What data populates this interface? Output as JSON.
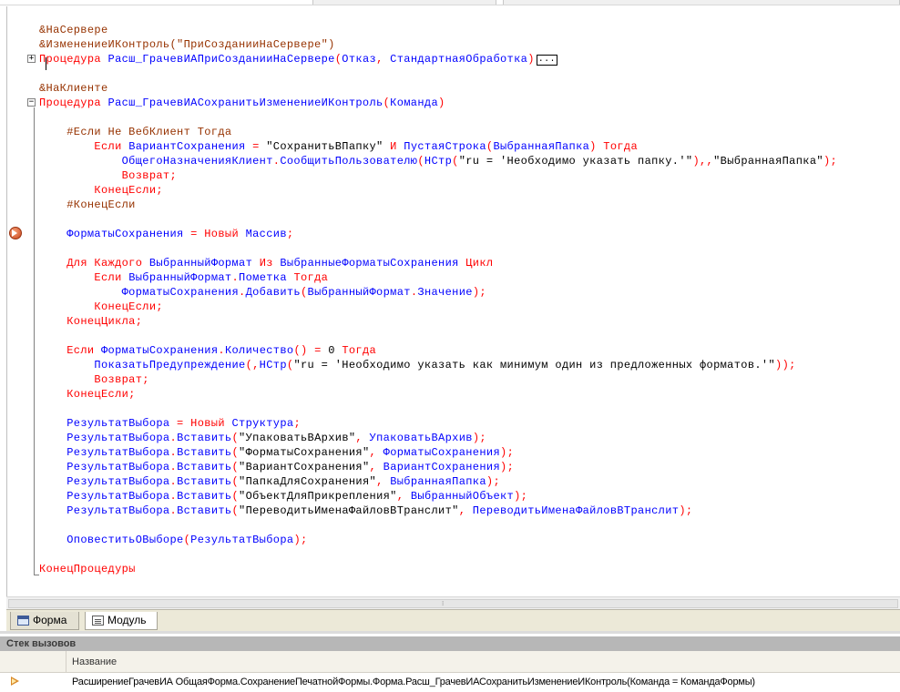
{
  "code_lines": [
    [
      {
        "c": "dir",
        "t": "&НаСервере"
      }
    ],
    [
      {
        "c": "dir",
        "t": "&ИзменениеИКонтроль(\"ПриСозданииНаСервере\")"
      }
    ],
    [
      {
        "c": "kw",
        "t": "Процедура"
      },
      {
        "c": "txt",
        "t": " "
      },
      {
        "c": "id",
        "t": "Расш_ГрачевИАПриСозданииНаСервере"
      },
      {
        "c": "kw",
        "t": "("
      },
      {
        "c": "id",
        "t": "Отказ"
      },
      {
        "c": "kw",
        "t": ", "
      },
      {
        "c": "id",
        "t": "СтандартнаяОбработка"
      },
      {
        "c": "kw",
        "t": ")"
      }
    ],
    [],
    [
      {
        "c": "dir",
        "t": "&НаКлиенте"
      }
    ],
    [
      {
        "c": "kw",
        "t": "Процедура"
      },
      {
        "c": "txt",
        "t": " "
      },
      {
        "c": "id",
        "t": "Расш_ГрачевИАСохранитьИзменениеИКонтроль"
      },
      {
        "c": "kw",
        "t": "("
      },
      {
        "c": "id",
        "t": "Команда"
      },
      {
        "c": "kw",
        "t": ")"
      }
    ],
    [],
    [
      {
        "c": "txt",
        "t": "    "
      },
      {
        "c": "dir",
        "t": "#Если Не ВебКлиент Тогда"
      }
    ],
    [
      {
        "c": "txt",
        "t": "        "
      },
      {
        "c": "kw",
        "t": "Если"
      },
      {
        "c": "txt",
        "t": " "
      },
      {
        "c": "id",
        "t": "ВариантСохранения"
      },
      {
        "c": "kw",
        "t": " = "
      },
      {
        "c": "txt",
        "t": "\"СохранитьВПапку\""
      },
      {
        "c": "kw",
        "t": " И "
      },
      {
        "c": "id",
        "t": "ПустаяСтрока"
      },
      {
        "c": "kw",
        "t": "("
      },
      {
        "c": "id",
        "t": "ВыбраннаяПапка"
      },
      {
        "c": "kw",
        "t": ") Тогда"
      }
    ],
    [
      {
        "c": "txt",
        "t": "            "
      },
      {
        "c": "id",
        "t": "ОбщегоНазначенияКлиент"
      },
      {
        "c": "kw",
        "t": "."
      },
      {
        "c": "id",
        "t": "СообщитьПользователю"
      },
      {
        "c": "kw",
        "t": "("
      },
      {
        "c": "id",
        "t": "НСтр"
      },
      {
        "c": "kw",
        "t": "("
      },
      {
        "c": "txt",
        "t": "\"ru = 'Необходимо указать папку.'\""
      },
      {
        "c": "kw",
        "t": "),,"
      },
      {
        "c": "txt",
        "t": "\"ВыбраннаяПапка\""
      },
      {
        "c": "kw",
        "t": ");"
      }
    ],
    [
      {
        "c": "txt",
        "t": "            "
      },
      {
        "c": "kw",
        "t": "Возврат;"
      }
    ],
    [
      {
        "c": "txt",
        "t": "        "
      },
      {
        "c": "kw",
        "t": "КонецЕсли;"
      }
    ],
    [
      {
        "c": "txt",
        "t": "    "
      },
      {
        "c": "dir",
        "t": "#КонецЕсли"
      }
    ],
    [],
    [
      {
        "c": "txt",
        "t": "    "
      },
      {
        "c": "id",
        "t": "ФорматыСохранения"
      },
      {
        "c": "kw",
        "t": " = Новый "
      },
      {
        "c": "id",
        "t": "Массив"
      },
      {
        "c": "kw",
        "t": ";"
      }
    ],
    [],
    [
      {
        "c": "txt",
        "t": "    "
      },
      {
        "c": "kw",
        "t": "Для Каждого"
      },
      {
        "c": "txt",
        "t": " "
      },
      {
        "c": "id",
        "t": "ВыбранныйФормат"
      },
      {
        "c": "kw",
        "t": " Из "
      },
      {
        "c": "id",
        "t": "ВыбранныеФорматыСохранения"
      },
      {
        "c": "kw",
        "t": " Цикл"
      }
    ],
    [
      {
        "c": "txt",
        "t": "        "
      },
      {
        "c": "kw",
        "t": "Если"
      },
      {
        "c": "txt",
        "t": " "
      },
      {
        "c": "id",
        "t": "ВыбранныйФормат"
      },
      {
        "c": "kw",
        "t": "."
      },
      {
        "c": "id",
        "t": "Пометка"
      },
      {
        "c": "kw",
        "t": " Тогда"
      }
    ],
    [
      {
        "c": "txt",
        "t": "            "
      },
      {
        "c": "id",
        "t": "ФорматыСохранения"
      },
      {
        "c": "kw",
        "t": "."
      },
      {
        "c": "id",
        "t": "Добавить"
      },
      {
        "c": "kw",
        "t": "("
      },
      {
        "c": "id",
        "t": "ВыбранныйФормат"
      },
      {
        "c": "kw",
        "t": "."
      },
      {
        "c": "id",
        "t": "Значение"
      },
      {
        "c": "kw",
        "t": ");"
      }
    ],
    [
      {
        "c": "txt",
        "t": "        "
      },
      {
        "c": "kw",
        "t": "КонецЕсли;"
      }
    ],
    [
      {
        "c": "txt",
        "t": "    "
      },
      {
        "c": "kw",
        "t": "КонецЦикла;"
      }
    ],
    [],
    [
      {
        "c": "txt",
        "t": "    "
      },
      {
        "c": "kw",
        "t": "Если"
      },
      {
        "c": "txt",
        "t": " "
      },
      {
        "c": "id",
        "t": "ФорматыСохранения"
      },
      {
        "c": "kw",
        "t": "."
      },
      {
        "c": "id",
        "t": "Количество"
      },
      {
        "c": "kw",
        "t": "() = "
      },
      {
        "c": "txt",
        "t": "0"
      },
      {
        "c": "kw",
        "t": " Тогда"
      }
    ],
    [
      {
        "c": "txt",
        "t": "        "
      },
      {
        "c": "id",
        "t": "ПоказатьПредупреждение"
      },
      {
        "c": "kw",
        "t": "(,"
      },
      {
        "c": "id",
        "t": "НСтр"
      },
      {
        "c": "kw",
        "t": "("
      },
      {
        "c": "txt",
        "t": "\"ru = 'Необходимо указать как минимум один из предложенных форматов.'\""
      },
      {
        "c": "kw",
        "t": "));"
      }
    ],
    [
      {
        "c": "txt",
        "t": "        "
      },
      {
        "c": "kw",
        "t": "Возврат;"
      }
    ],
    [
      {
        "c": "txt",
        "t": "    "
      },
      {
        "c": "kw",
        "t": "КонецЕсли;"
      }
    ],
    [],
    [
      {
        "c": "txt",
        "t": "    "
      },
      {
        "c": "id",
        "t": "РезультатВыбора"
      },
      {
        "c": "kw",
        "t": " = Новый "
      },
      {
        "c": "id",
        "t": "Структура"
      },
      {
        "c": "kw",
        "t": ";"
      }
    ],
    [
      {
        "c": "txt",
        "t": "    "
      },
      {
        "c": "id",
        "t": "РезультатВыбора"
      },
      {
        "c": "kw",
        "t": "."
      },
      {
        "c": "id",
        "t": "Вставить"
      },
      {
        "c": "kw",
        "t": "("
      },
      {
        "c": "txt",
        "t": "\"УпаковатьВАрхив\""
      },
      {
        "c": "kw",
        "t": ", "
      },
      {
        "c": "id",
        "t": "УпаковатьВАрхив"
      },
      {
        "c": "kw",
        "t": ");"
      }
    ],
    [
      {
        "c": "txt",
        "t": "    "
      },
      {
        "c": "id",
        "t": "РезультатВыбора"
      },
      {
        "c": "kw",
        "t": "."
      },
      {
        "c": "id",
        "t": "Вставить"
      },
      {
        "c": "kw",
        "t": "("
      },
      {
        "c": "txt",
        "t": "\"ФорматыСохранения\""
      },
      {
        "c": "kw",
        "t": ", "
      },
      {
        "c": "id",
        "t": "ФорматыСохранения"
      },
      {
        "c": "kw",
        "t": ");"
      }
    ],
    [
      {
        "c": "txt",
        "t": "    "
      },
      {
        "c": "id",
        "t": "РезультатВыбора"
      },
      {
        "c": "kw",
        "t": "."
      },
      {
        "c": "id",
        "t": "Вставить"
      },
      {
        "c": "kw",
        "t": "("
      },
      {
        "c": "txt",
        "t": "\"ВариантСохранения\""
      },
      {
        "c": "kw",
        "t": ", "
      },
      {
        "c": "id",
        "t": "ВариантСохранения"
      },
      {
        "c": "kw",
        "t": ");"
      }
    ],
    [
      {
        "c": "txt",
        "t": "    "
      },
      {
        "c": "id",
        "t": "РезультатВыбора"
      },
      {
        "c": "kw",
        "t": "."
      },
      {
        "c": "id",
        "t": "Вставить"
      },
      {
        "c": "kw",
        "t": "("
      },
      {
        "c": "txt",
        "t": "\"ПапкаДляСохранения\""
      },
      {
        "c": "kw",
        "t": ", "
      },
      {
        "c": "id",
        "t": "ВыбраннаяПапка"
      },
      {
        "c": "kw",
        "t": ");"
      }
    ],
    [
      {
        "c": "txt",
        "t": "    "
      },
      {
        "c": "id",
        "t": "РезультатВыбора"
      },
      {
        "c": "kw",
        "t": "."
      },
      {
        "c": "id",
        "t": "Вставить"
      },
      {
        "c": "kw",
        "t": "("
      },
      {
        "c": "txt",
        "t": "\"ОбъектДляПрикрепления\""
      },
      {
        "c": "kw",
        "t": ", "
      },
      {
        "c": "id",
        "t": "ВыбранныйОбъект"
      },
      {
        "c": "kw",
        "t": ");"
      }
    ],
    [
      {
        "c": "txt",
        "t": "    "
      },
      {
        "c": "id",
        "t": "РезультатВыбора"
      },
      {
        "c": "kw",
        "t": "."
      },
      {
        "c": "id",
        "t": "Вставить"
      },
      {
        "c": "kw",
        "t": "("
      },
      {
        "c": "txt",
        "t": "\"ПереводитьИменаФайловВТранслит\""
      },
      {
        "c": "kw",
        "t": ", "
      },
      {
        "c": "id",
        "t": "ПереводитьИменаФайловВТранслит"
      },
      {
        "c": "kw",
        "t": ");"
      }
    ],
    [],
    [
      {
        "c": "txt",
        "t": "    "
      },
      {
        "c": "id",
        "t": "ОповеститьОВыборе"
      },
      {
        "c": "kw",
        "t": "("
      },
      {
        "c": "id",
        "t": "РезультатВыбора"
      },
      {
        "c": "kw",
        "t": ");"
      }
    ],
    [],
    [
      {
        "c": "kw",
        "t": "КонецПроцедуры"
      }
    ]
  ],
  "collapsed_marker": "...",
  "tabs": [
    {
      "label": "Форма",
      "icon": "form-icon"
    },
    {
      "label": "Модуль",
      "icon": "module-icon"
    }
  ],
  "call_stack": {
    "title": "Стек вызовов",
    "column_name": "Название",
    "rows": [
      {
        "icon": "current-frame-arrow-icon",
        "text": "РасширениеГрачевИА ОбщаяФорма.СохранениеПечатнойФормы.Форма.Расш_ГрачевИАСохранитьИзменениеИКонтроль(Команда = КомандаФормы)"
      }
    ]
  },
  "colors": {
    "keyword": "#ff0000",
    "identifier": "#0000ff",
    "directive": "#963200",
    "string": "#000000",
    "call_stack_title_bg": "#b7b7b7"
  },
  "breakpoint_icon": "breakpoint-current-line-icon"
}
